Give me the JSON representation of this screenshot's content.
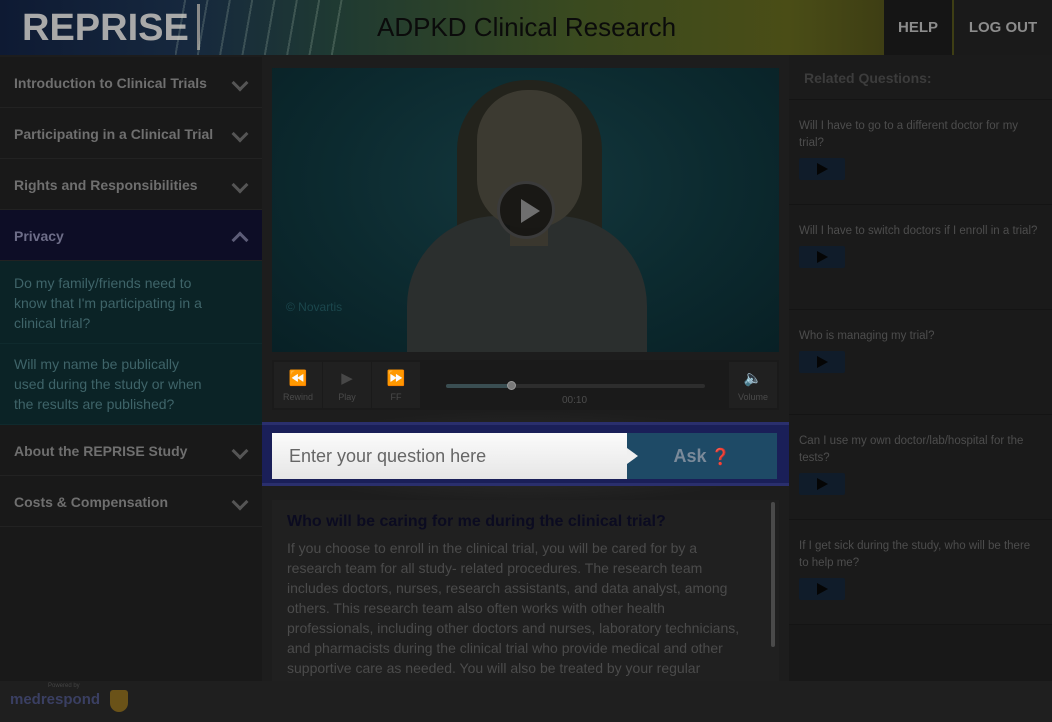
{
  "header": {
    "logo": "REPRISE",
    "title": "ADPKD Clinical Research",
    "help_label": "HELP",
    "logout_label": "LOG OUT"
  },
  "sidebar": {
    "items": [
      {
        "label": "Introduction to Clinical Trials",
        "state": "collapsed"
      },
      {
        "label": "Participating in a Clinical Trial",
        "state": "collapsed"
      },
      {
        "label": "Rights and Responsibilities",
        "state": "collapsed"
      },
      {
        "label": "Privacy",
        "state": "expanded"
      },
      {
        "label": "About the REPRISE Study",
        "state": "collapsed"
      },
      {
        "label": "Costs & Compensation",
        "state": "collapsed"
      }
    ],
    "privacy_subitems": [
      "Do my family/friends need to know that I'm participating in a clinical trial?",
      "Will my name be publically used during the study or when the results are published?"
    ]
  },
  "video": {
    "watermark": "© Novartis",
    "controls": {
      "rewind": "Rewind",
      "play": "Play",
      "ff": "FF",
      "volume": "Volume",
      "time": "00:10",
      "progress": 0.25
    }
  },
  "ask": {
    "placeholder": "Enter your question here",
    "button_label": "Ask"
  },
  "answer": {
    "title": "Who will be caring for me during the clinical trial?",
    "body": "If you choose to enroll in the clinical trial, you will be cared for by a research team for all study- related procedures. The research team includes doctors, nurses, research assistants, and data analyst, among others. This research team also often works with other health professionals, including other doctors and nurses, laboratory technicians, and pharmacists during the clinical trial who provide medical and other supportive care as needed. You will also be treated by your regular physician over the course of the study"
  },
  "related": {
    "header": "Related Questions:",
    "questions": [
      "Will I have to go to a different doctor for my trial?",
      "Will I have to switch doctors if I enroll in a trial?",
      "Who is managing my trial?",
      "Can I use my own doctor/lab/hospital for the tests?",
      "If I get sick during the study, who will be there to help me?"
    ]
  },
  "footer": {
    "powered_by": "Powered by",
    "brand": "medrespond"
  }
}
